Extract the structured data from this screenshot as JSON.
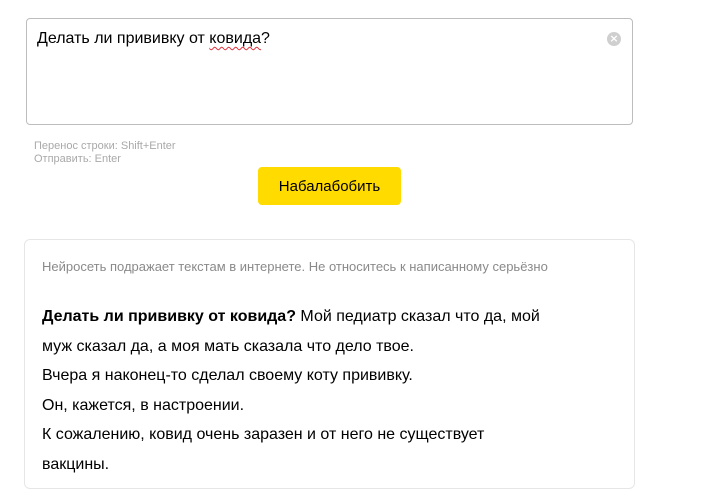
{
  "input": {
    "text_before": "Делать ли прививку от ",
    "text_misspelled": "ковида",
    "text_after": "?",
    "clear_icon": "clear-circle-icon"
  },
  "hints": {
    "newline": "Перенос строки: Shift+Enter",
    "send": "Отправить: Enter"
  },
  "submit_label": "Набалабобить",
  "colors": {
    "button": "#ffdb00",
    "spellcheck_underline": "#e0303a"
  },
  "result": {
    "disclaimer": "Нейросеть подражает текстам в интернете. Не относитесь к написанному серьёзно",
    "prompt_bold": "Делать ли прививку от ковида?",
    "lines": [
      " Мой педиатр сказал что да, мой",
      "муж сказал да, а моя мать сказала что дело твое.",
      "Вчера я наконец-то сделал своему коту прививку.",
      "Он, кажется, в настроении.",
      "К сожалению, ковид очень заразен и от него не существует",
      "вакцины."
    ]
  }
}
